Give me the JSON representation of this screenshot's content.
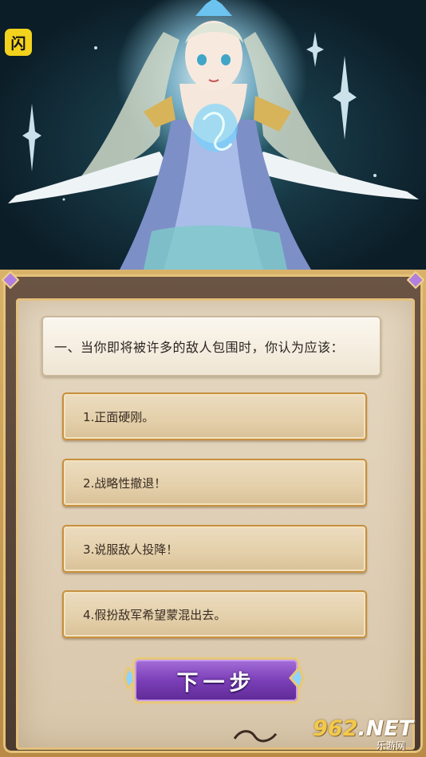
{
  "logo": {
    "glyph": "闪"
  },
  "question": {
    "text": "一、当你即将被许多的敌人包围时，你认为应该："
  },
  "options": [
    {
      "label": "1.正面硬刚。"
    },
    {
      "label": "2.战略性撤退！"
    },
    {
      "label": "3.说服敌人投降！"
    },
    {
      "label": "4.假扮敌军希望蒙混出去。"
    }
  ],
  "next_button": {
    "label": "下一步"
  },
  "watermark": {
    "brand": "962.NET",
    "brand_number": "962",
    "brand_suffix": ".NET",
    "site": "乐游网"
  },
  "colors": {
    "panel_frame": "#e4c07c",
    "option_border": "#c7903f",
    "button_purple": "#7b3fb8",
    "logo_yellow": "#f2d21c"
  }
}
